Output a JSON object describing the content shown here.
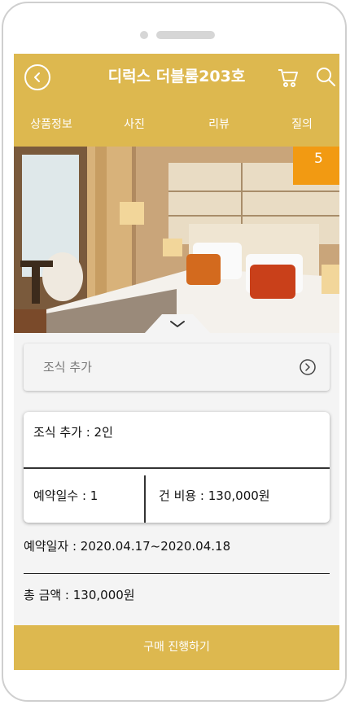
{
  "header": {
    "title": "디럭스 더블룸203호",
    "back_icon": "chevron-left-icon",
    "cart_icon": "cart-icon",
    "search_icon": "search-icon",
    "bg_color": "#ddb84f"
  },
  "tabs": [
    {
      "label": "상품정보"
    },
    {
      "label": "사진"
    },
    {
      "label": "리뷰"
    },
    {
      "label": "질의"
    }
  ],
  "photo": {
    "count": "5",
    "badge_color": "#f29a12",
    "expand_icon": "chevron-down-icon"
  },
  "options": {
    "breakfast_add_label": "조식 추가",
    "arrow_icon": "circle-arrow-right-icon"
  },
  "summary": {
    "breakfast": "조식 추가 : 2인",
    "days": "예약일수 : 1",
    "cost": "건 비용 : 130,000원"
  },
  "reservation": {
    "dates": "예약일자 : 2020.04.17~2020.04.18",
    "total": "총 금액 : 130,000원"
  },
  "actions": {
    "purchase_label": "구매 진행하기"
  }
}
